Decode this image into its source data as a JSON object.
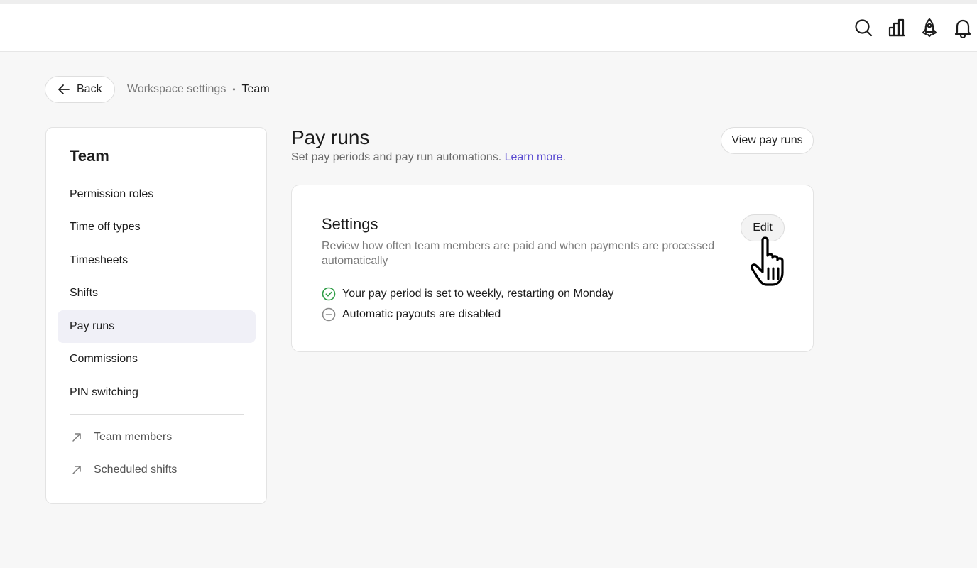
{
  "topbar": {
    "icons": [
      "search-icon",
      "chart-icon",
      "rocket-icon",
      "bell-icon"
    ]
  },
  "nav": {
    "back_label": "Back",
    "breadcrumb_parent": "Workspace settings",
    "breadcrumb_separator": "•",
    "breadcrumb_current": "Team"
  },
  "sidebar": {
    "title": "Team",
    "items": [
      {
        "label": "Permission roles"
      },
      {
        "label": "Time off types"
      },
      {
        "label": "Timesheets"
      },
      {
        "label": "Shifts"
      },
      {
        "label": "Pay runs",
        "active": true
      },
      {
        "label": "Commissions"
      },
      {
        "label": "PIN switching"
      }
    ],
    "links": [
      {
        "label": "Team members",
        "icon": "arrow-up-right-icon"
      },
      {
        "label": "Scheduled shifts",
        "icon": "arrow-up-right-icon"
      }
    ]
  },
  "main": {
    "title": "Pay runs",
    "subtitle": "Set pay periods and pay run automations.",
    "learn_more": "Learn more",
    "learn_more_suffix": ".",
    "view_button": "View pay runs"
  },
  "settings": {
    "title": "Settings",
    "description": "Review how often team members are paid and when payments are processed automatically",
    "edit_label": "Edit",
    "statuses": [
      {
        "text": "Your pay period is set to weekly, restarting on Monday",
        "state": "enabled",
        "icon": "check-circle-icon"
      },
      {
        "text": "Automatic payouts are disabled",
        "state": "disabled",
        "icon": "minus-circle-icon"
      }
    ]
  },
  "colors": {
    "accent": "#5a4bd1",
    "active_item_bg": "#f0f0f7",
    "success": "#2e9d46",
    "muted": "#8a8a8a"
  }
}
